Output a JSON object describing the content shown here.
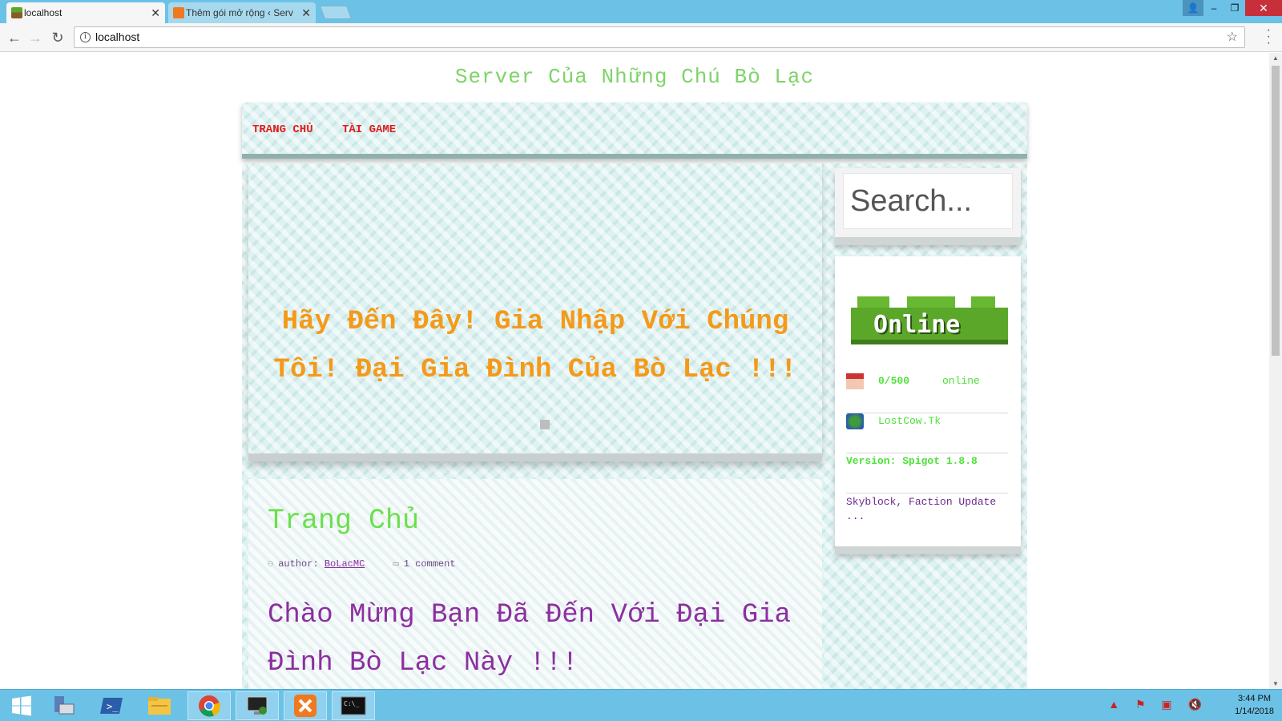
{
  "browser": {
    "tabs": [
      {
        "title": "localhost",
        "active": true,
        "favicon": "grass-block-icon"
      },
      {
        "title": "Thêm gói mở rộng ‹ Serv",
        "active": false,
        "favicon": "xampp-icon"
      }
    ],
    "address": "localhost",
    "window_buttons": {
      "minimize": "–",
      "restore": "❐",
      "close": "✕"
    }
  },
  "site": {
    "title": "Server Của Những Chú Bò Lạc",
    "nav": [
      "TRANG CHỦ",
      "TÀI GAME"
    ]
  },
  "hero": {
    "text": "Hãy Đến Đây! Gia Nhập Với Chúng Tôi! Đại Gia Đình Của Bò Lạc !!!"
  },
  "post": {
    "title": "Trang Chủ",
    "author_prefix": "author:",
    "author": "BoLacMC",
    "comments": "1 comment",
    "body": "Chào Mừng Bạn Đã Đến Với Đại Gia Đình Bò Lạc Này !!!"
  },
  "sidebar": {
    "search_placeholder": "Search...",
    "status_banner": "Online",
    "players": "0/500",
    "players_suffix": "online",
    "address": "LostCow.Tk",
    "version": "Version: Spigot 1.8.8",
    "motd": "Skyblock, Faction Update ..."
  },
  "taskbar": {
    "time": "3:44 PM",
    "date": "1/14/2018",
    "apps": [
      "windows-start-icon",
      "server-manager-icon",
      "powershell-icon",
      "file-explorer-icon",
      "chrome-icon",
      "remote-desktop-icon",
      "xampp-icon",
      "command-prompt-icon"
    ]
  },
  "colors": {
    "accent_title": "#7fd36a",
    "nav": "#e01d1d",
    "hero": "#f49a1a",
    "post_title": "#6be04d",
    "post_body": "#8c2fa0",
    "browser_chrome": "#6bc2e6"
  }
}
